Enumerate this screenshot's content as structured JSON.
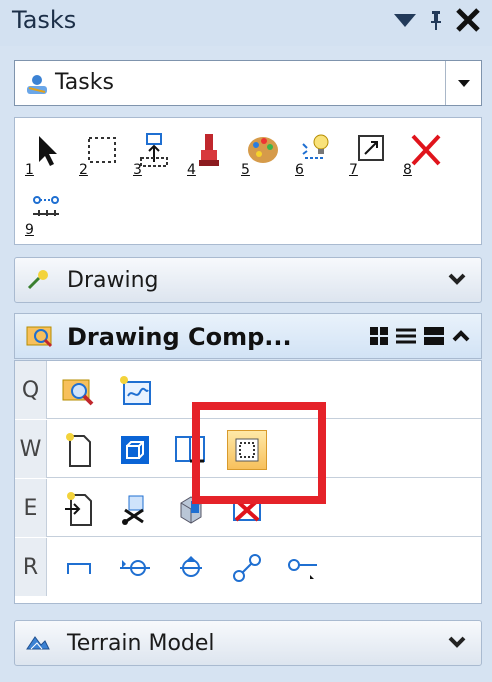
{
  "window": {
    "title": "Tasks"
  },
  "task_selector": {
    "value": "Tasks"
  },
  "toolbox": {
    "tools": [
      {
        "key": "1",
        "icon": "select-element-icon"
      },
      {
        "key": "2",
        "icon": "place-fence-icon"
      },
      {
        "key": "3",
        "icon": "move-icon"
      },
      {
        "key": "4",
        "icon": "paint-brush-icon"
      },
      {
        "key": "5",
        "icon": "palette-icon"
      },
      {
        "key": "6",
        "icon": "highlight-bulb-icon"
      },
      {
        "key": "7",
        "icon": "scale-icon"
      },
      {
        "key": "8",
        "icon": "delete-icon"
      },
      {
        "key": "9",
        "icon": "measure-distance-icon"
      }
    ]
  },
  "sections": {
    "drawing": {
      "label": "Drawing"
    },
    "drawing_composition": {
      "label": "Drawing  Comp..."
    },
    "terrain_model": {
      "label": "Terrain Model"
    }
  },
  "drawing_composition_rows": [
    {
      "key": "Q"
    },
    {
      "key": "W"
    },
    {
      "key": "E"
    },
    {
      "key": "R"
    }
  ],
  "colors": {
    "highlight": "#e52229",
    "accent": "#0a64d6"
  }
}
